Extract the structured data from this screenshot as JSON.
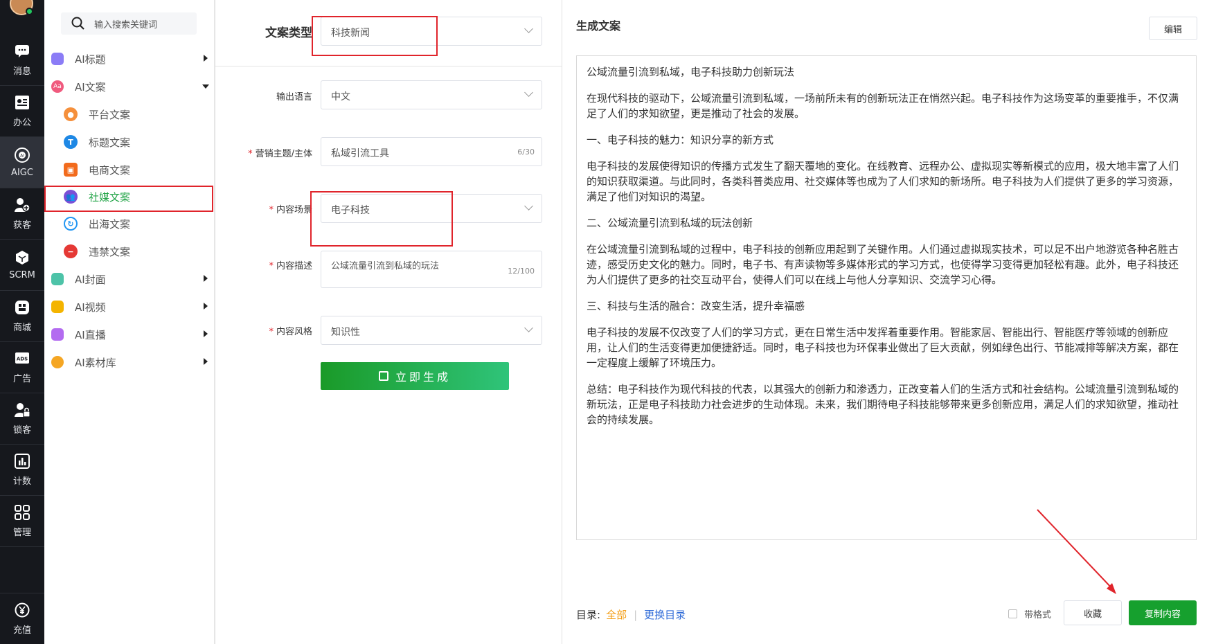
{
  "rail": {
    "items": [
      {
        "label": "消息",
        "icon": "chat-bubble-icon"
      },
      {
        "label": "办公",
        "icon": "contact-card-icon"
      },
      {
        "label": "AIGC",
        "icon": "ai-chip-icon"
      },
      {
        "label": "获客",
        "icon": "add-user-icon"
      },
      {
        "label": "SCRM",
        "icon": "cube-icon"
      },
      {
        "label": "商城",
        "icon": "store-icon"
      },
      {
        "label": "广告",
        "icon": "ads-icon"
      },
      {
        "label": "锁客",
        "icon": "lock-user-icon"
      },
      {
        "label": "计数",
        "icon": "bar-chart-icon"
      },
      {
        "label": "管理",
        "icon": "grid-icon"
      },
      {
        "label": "充值",
        "icon": "yen-coin-icon"
      }
    ]
  },
  "menu": {
    "search_placeholder": "输入搜索关键词",
    "groups": [
      {
        "label": "AI标题"
      },
      {
        "label": "AI文案"
      },
      {
        "label": "AI封面"
      },
      {
        "label": "AI视频"
      },
      {
        "label": "AI直播"
      },
      {
        "label": "AI素材库"
      }
    ],
    "sub_items": [
      {
        "label": "平台文案"
      },
      {
        "label": "标题文案"
      },
      {
        "label": "电商文案"
      },
      {
        "label": "社媒文案"
      },
      {
        "label": "出海文案"
      },
      {
        "label": "违禁文案"
      }
    ]
  },
  "form": {
    "type_label": "文案类型",
    "type_value": "科技新闻",
    "lang_label": "输出语言",
    "lang_value": "中文",
    "topic_label": "营销主题/主体",
    "topic_value": "私域引流工具",
    "topic_count": "6/30",
    "scene_label": "内容场景",
    "scene_value": "电子科技",
    "desc_label": "内容描述",
    "desc_value": "公域流量引流到私域的玩法",
    "desc_count": "12/100",
    "style_label": "内容风格",
    "style_value": "知识性",
    "star": "*",
    "generate_label": "立即生成"
  },
  "output": {
    "title": "生成文案",
    "edit_label": "编辑",
    "paragraphs": [
      "公域流量引流到私域，电子科技助力创新玩法",
      "在现代科技的驱动下，公域流量引流到私域，一场前所未有的创新玩法正在悄然兴起。电子科技作为这场变革的重要推手，不仅满足了人们的求知欲望，更是推动了社会的发展。",
      "一、电子科技的魅力：知识分享的新方式",
      "电子科技的发展使得知识的传播方式发生了翻天覆地的变化。在线教育、远程办公、虚拟现实等新模式的应用，极大地丰富了人们的知识获取渠道。与此同时，各类科普类应用、社交媒体等也成为了人们求知的新场所。电子科技为人们提供了更多的学习资源，满足了他们对知识的渴望。",
      "二、公域流量引流到私域的玩法创新",
      "在公域流量引流到私域的过程中，电子科技的创新应用起到了关键作用。人们通过虚拟现实技术，可以足不出户地游览各种名胜古迹，感受历史文化的魅力。同时，电子书、有声读物等多媒体形式的学习方式，也使得学习变得更加轻松有趣。此外，电子科技还为人们提供了更多的社交互动平台，使得人们可以在线上与他人分享知识、交流学习心得。",
      "三、科技与生活的融合：改变生活，提升幸福感",
      "电子科技的发展不仅改变了人们的学习方式，更在日常生活中发挥着重要作用。智能家居、智能出行、智能医疗等领域的创新应用，让人们的生活变得更加便捷舒适。同时，电子科技也为环保事业做出了巨大贡献，例如绿色出行、节能减排等解决方案，都在一定程度上缓解了环境压力。",
      "总结：电子科技作为现代科技的代表，以其强大的创新力和渗透力，正改变着人们的生活方式和社会结构。公域流量引流到私域的新玩法，正是电子科技助力社会进步的生动体现。未来，我们期待电子科技能够带来更多创新应用，满足人们的求知欲望，推动社会的持续发展。"
    ],
    "catalog_label": "目录:",
    "catalog_all": "全部",
    "catalog_sep": "|",
    "catalog_change": "更换目录",
    "format_label": "带格式",
    "favorite_label": "收藏",
    "copy_label": "复制内容"
  },
  "colors": {
    "accent_green": "#16a02e",
    "annotation_red": "#e0242b",
    "rail_bg": "#16181d"
  }
}
